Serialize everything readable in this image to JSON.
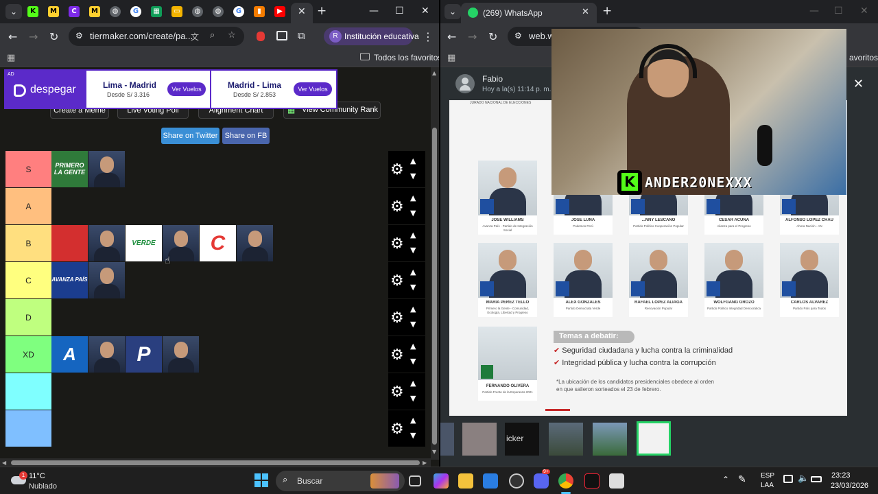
{
  "left_browser": {
    "url": "tiermaker.com/create/pa...",
    "profile_label": "Institución educativa",
    "profile_initial": "R",
    "bookmarks_label": "Todos los favoritos",
    "tab_icons": [
      "K",
      "M",
      "C",
      "M",
      "G",
      "G",
      "G",
      "G",
      "G",
      "G",
      "M",
      "YT"
    ]
  },
  "ad": {
    "badge": "AD",
    "brand": "despegar",
    "cards": [
      {
        "route": "Lima - Madrid",
        "price": "Desde S/ 3.316",
        "button": "Ver Vuelos"
      },
      {
        "route": "Madrid - Lima",
        "price": "Desde S/ 2.853",
        "button": "Ver Vuelos"
      }
    ]
  },
  "tool_buttons": [
    "Create a Meme",
    "Live Voting Poll",
    "Alignment Chart",
    "View Community Rank"
  ],
  "share": {
    "twitter": "Share on Twitter",
    "fb": "Share on FB"
  },
  "tiers": [
    {
      "label": "S",
      "color": "#ff7f7f",
      "items": [
        "PRIMERO LA GENTE",
        "portrait"
      ]
    },
    {
      "label": "A",
      "color": "#ffbf7f",
      "items": []
    },
    {
      "label": "B",
      "color": "#ffdf7f",
      "items": [
        "logo-red",
        "portrait",
        "VERDE",
        "portrait",
        "logo-c",
        "portrait"
      ]
    },
    {
      "label": "C",
      "color": "#ffff7f",
      "items": [
        "AVANZA PAÍS",
        "portrait"
      ]
    },
    {
      "label": "D",
      "color": "#bfff7f",
      "items": []
    },
    {
      "label": "XD",
      "color": "#7fff7f",
      "items": [
        "A",
        "portrait",
        "P",
        "portrait"
      ]
    },
    {
      "label": "",
      "color": "#7fffff",
      "items": []
    },
    {
      "label": "",
      "color": "#7fbfff",
      "items": []
    }
  ],
  "right_browser": {
    "tab_title": "(269) WhatsApp",
    "url": "web.w",
    "bookmarks_tail": "avoritos"
  },
  "whatsapp": {
    "contact": "Fabio",
    "time": "Hoy a la(s) 11:14 p. m.",
    "watermark": "ANDER20NEXXX",
    "poster_header": "JURADO NACIONAL DE ELECCIONES",
    "candidates_row1": [
      {
        "name": "JOSÉ WILLIAMS",
        "party": "Avanza País - Partido de Integración Social"
      },
      {
        "name": "JOSÉ LUNA",
        "party": "Podemos Perú"
      },
      {
        "name": "...NNY LESCANO",
        "party": "Partido Político Cooperación Popular"
      },
      {
        "name": "CÉSAR ACUÑA",
        "party": "Alianza para el Progreso"
      },
      {
        "name": "ALFONSO LÓPEZ CHAU",
        "party": "Ahora Nación - AN"
      }
    ],
    "candidates_row2": [
      {
        "name": "MARÍA PÉREZ TELLO",
        "party": "Primero la Gente - Comunidad, Ecología, Libertad y Progreso"
      },
      {
        "name": "ÁLEX GONZALES",
        "party": "Partido Democrata Verde"
      },
      {
        "name": "RAFAEL LÓPEZ ALIAGA",
        "party": "Renovación Popular"
      },
      {
        "name": "WOLFGANG GROZO",
        "party": "Partido Político Integridad Democrática"
      },
      {
        "name": "CARLOS ÁLVAREZ",
        "party": "Partido País para Todos"
      }
    ],
    "candidate_row3": {
      "name": "FERNANDO OLIVERA",
      "party": "Partido Frente de la Esperanza 2021"
    },
    "topics_title": "Temas a debatir:",
    "topics": [
      "Seguridad ciudadana y lucha contra la criminalidad",
      "Integridad pública y lucha contra la corrupción"
    ],
    "note": "*La ubicación de los candidatos presidenciales obedece al orden en que salieron sorteados el 23 de febrero.",
    "thumb_label": "icker"
  },
  "taskbar": {
    "weather_temp": "11°C",
    "weather_desc": "Nublado",
    "weather_badge": "1",
    "search": "Buscar",
    "lang1": "ESP",
    "lang2": "LAA",
    "time": "23:23",
    "date": "23/03/2026",
    "discord_badge": "9+"
  }
}
